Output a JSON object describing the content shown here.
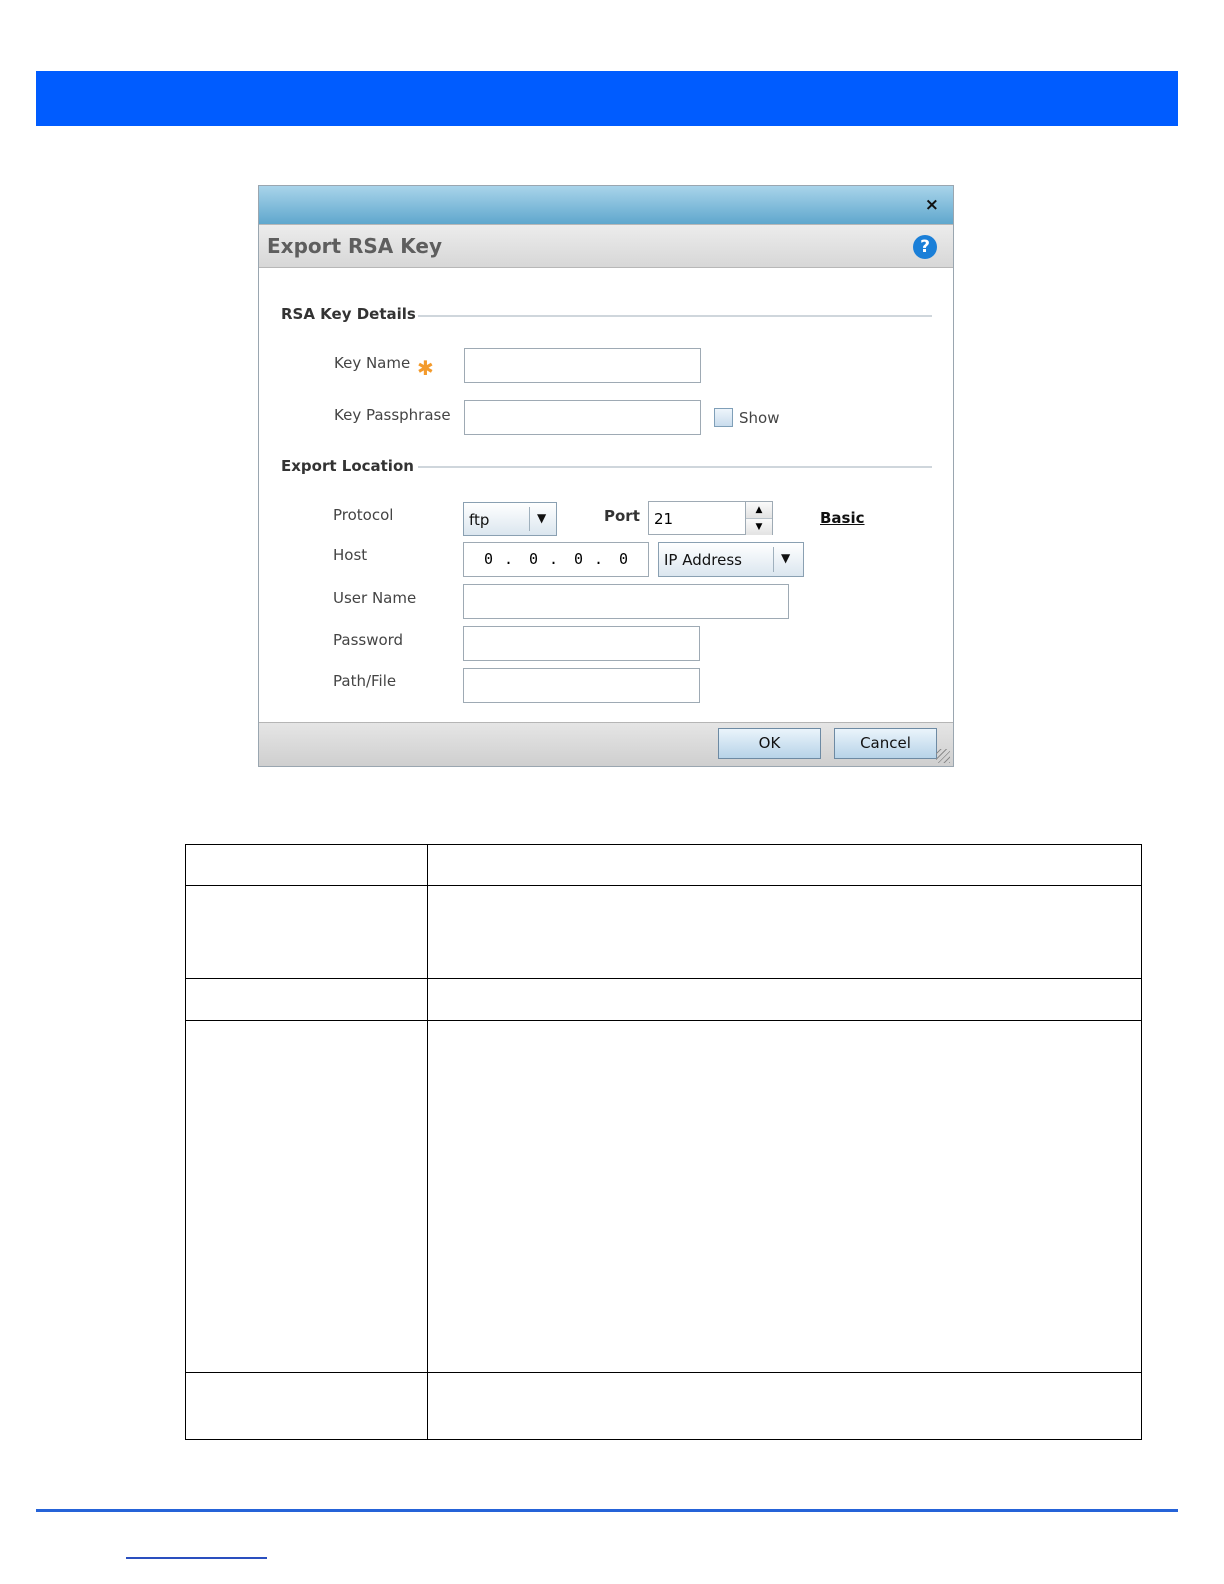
{
  "dialog": {
    "title": "Export RSA Key",
    "close_glyph": "×",
    "help_glyph": "?",
    "sections": {
      "key_details": "RSA Key Details",
      "export_location": "Export Location"
    },
    "key_name": {
      "label": "Key Name",
      "value": ""
    },
    "key_passphrase": {
      "label": "Key Passphrase",
      "value": "",
      "show_label": "Show",
      "show_checked": false
    },
    "protocol": {
      "label": "Protocol",
      "selected": "ftp"
    },
    "port": {
      "label": "Port",
      "value": "21"
    },
    "basic_link": "Basic",
    "host": {
      "label": "Host",
      "octets": [
        "0",
        "0",
        "0",
        "0"
      ],
      "type_selected": "IP Address"
    },
    "user_name": {
      "label": "User Name",
      "value": ""
    },
    "password": {
      "label": "Password",
      "value": ""
    },
    "path_file": {
      "label": "Path/File",
      "value": ""
    },
    "buttons": {
      "ok": "OK",
      "cancel": "Cancel"
    }
  },
  "colors": {
    "banner": "#005cff",
    "required_star": "#f39a2b",
    "help_icon": "#1a7fd8",
    "bottom_rule": "#2563d8"
  },
  "icons": [
    "close-icon",
    "help-icon",
    "required-star-icon",
    "chevron-down-icon",
    "spin-up-icon",
    "spin-down-icon",
    "resize-grip-icon"
  ]
}
